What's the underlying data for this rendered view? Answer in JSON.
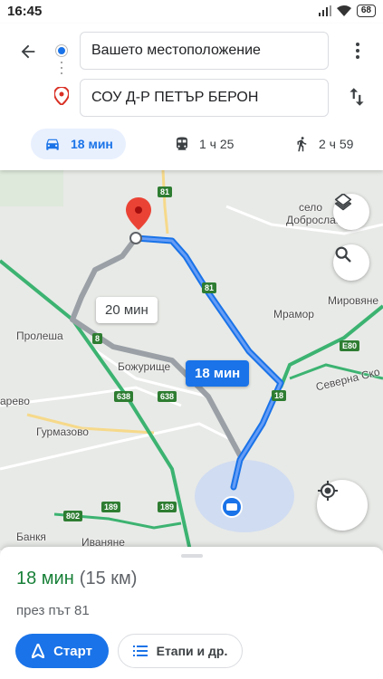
{
  "status_bar": {
    "time": "16:45",
    "battery": "68"
  },
  "header": {
    "origin": "Вашето местоположение",
    "destination": "СОУ Д-Р ПЕТЪР БЕРОН"
  },
  "modes": [
    {
      "label": "18 мин",
      "icon": "car-icon",
      "active": true
    },
    {
      "label": "1 ч 25",
      "icon": "train-icon",
      "active": false
    },
    {
      "label": "2 ч 59",
      "icon": "walk-icon",
      "active": false
    }
  ],
  "map": {
    "places": [
      "село",
      "Доброславц",
      "Мировяне",
      "Мрамор",
      "Пролеша",
      "Божурище",
      "арево",
      "Гурмазово",
      "Банкя",
      "Иваняне",
      "Северна Ско"
    ],
    "road_shields": [
      "81",
      "81",
      "8",
      "638",
      "638",
      "18",
      "E80",
      "802",
      "189",
      "189"
    ],
    "callouts": {
      "alternative": "20 мин",
      "main": "18 мин"
    },
    "colors": {
      "route": "#1a73e8",
      "alt_route": "#9aa0a6",
      "highway": "#3cb371"
    }
  },
  "sheet": {
    "duration": "18 мин",
    "distance": "(15 км)",
    "via": "през път 81",
    "start_label": "Старт",
    "steps_label": "Етапи и др."
  }
}
